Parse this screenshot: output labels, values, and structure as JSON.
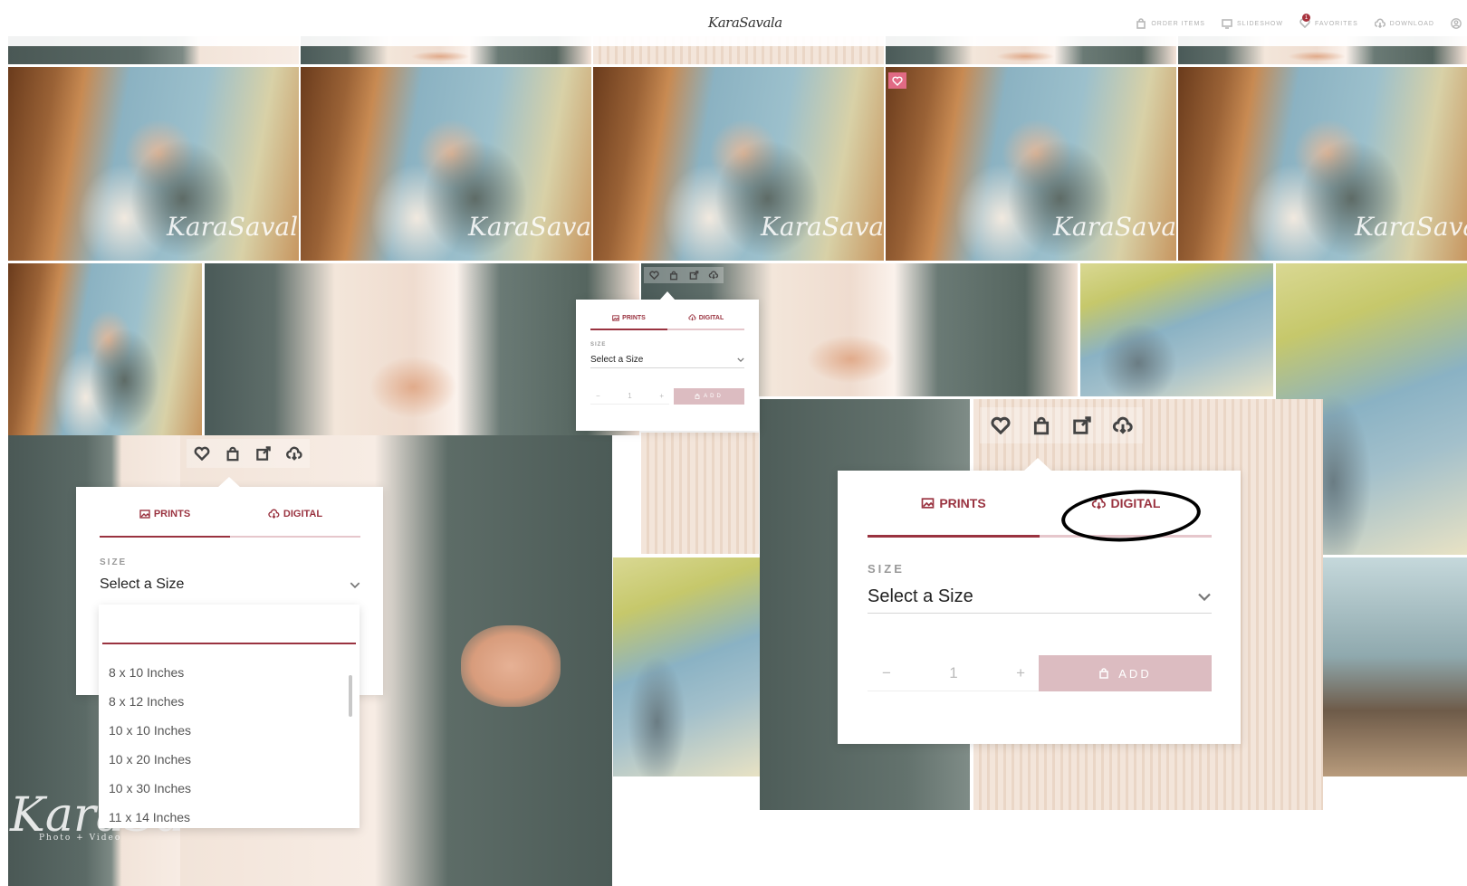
{
  "header": {
    "logo": "KaraSavala",
    "nav": [
      {
        "icon": "bag-icon",
        "label": "ORDER ITEMS"
      },
      {
        "icon": "monitor-icon",
        "label": "SLIDESHOW"
      },
      {
        "icon": "heart-icon",
        "label": "FAVORITES",
        "badge": "1"
      },
      {
        "icon": "cloud-download-icon",
        "label": "DOWNLOAD"
      }
    ]
  },
  "gallery": {
    "watermark_text": "KaraSavala",
    "watermark_sub": "Photo + Video"
  },
  "product_panel": {
    "tabs": [
      {
        "icon": "image-icon",
        "label": "PRINTS"
      },
      {
        "icon": "cloud-download-icon",
        "label": "DIGITAL"
      }
    ],
    "active_tab": "PRINTS",
    "size_label": "SIZE",
    "size_placeholder": "Select a Size",
    "quantity": "1",
    "qty_minus": "−",
    "qty_plus": "+",
    "add_label": "ADD"
  },
  "size_dropdown": {
    "search_value": "",
    "options": [
      "8 x 10 Inches",
      "8 x 12 Inches",
      "10 x 10 Inches",
      "10 x 20 Inches",
      "10 x 30 Inches",
      "11 x 14 Inches"
    ]
  },
  "colors": {
    "accent": "#9a3340",
    "accent_light": "#dcbcc1",
    "favorite_badge": "#a8323d"
  }
}
